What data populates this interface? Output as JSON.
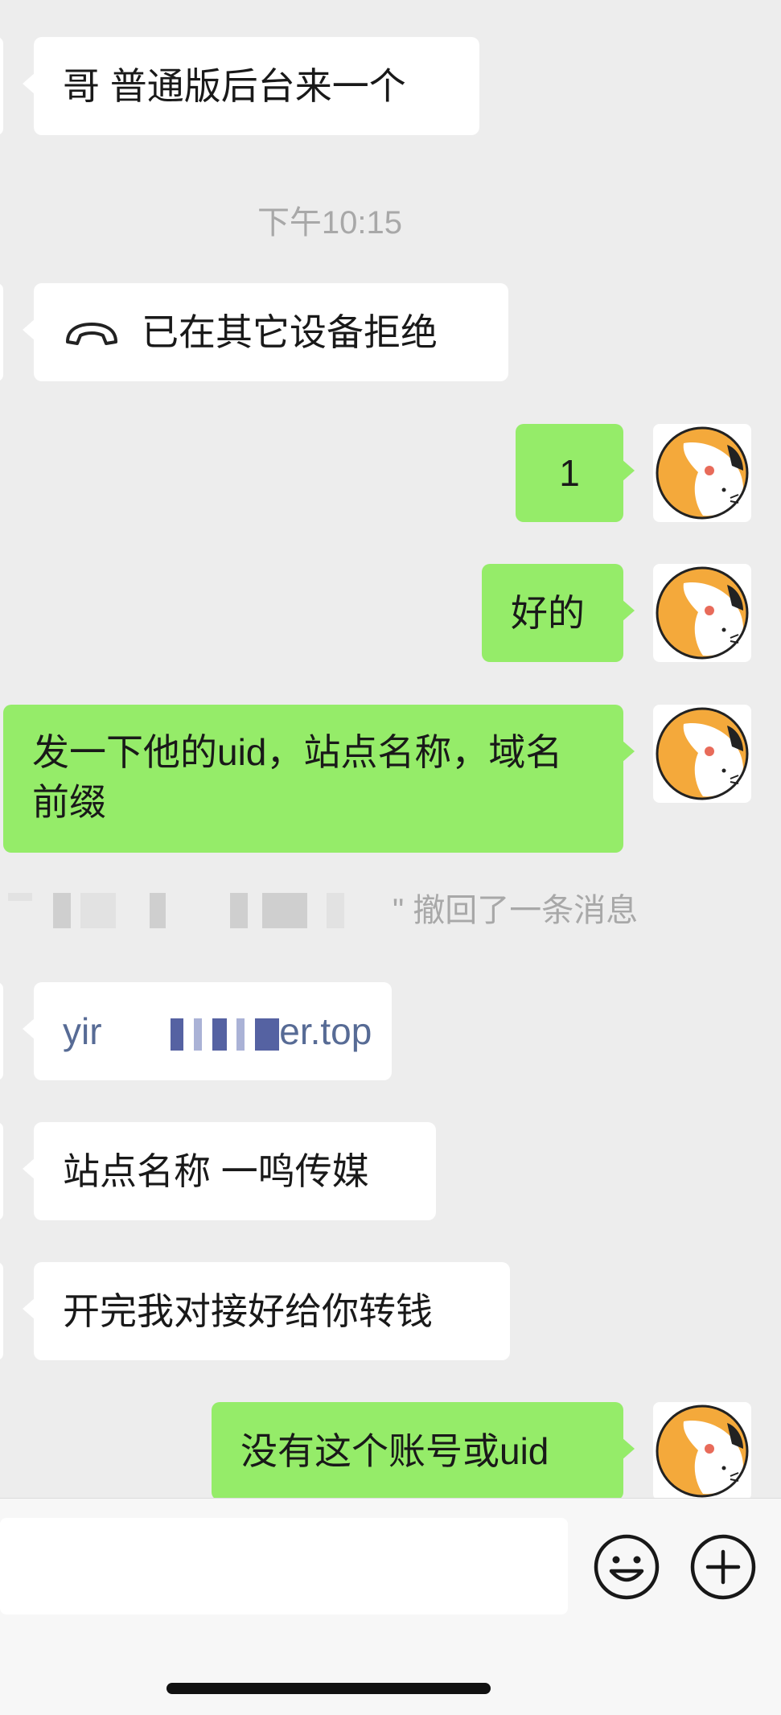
{
  "messages": {
    "m1": "哥 普通版后台来一个",
    "time": "下午10:15",
    "call": "已在其它设备拒绝",
    "m2": "1",
    "m3": "好的",
    "m4": "发一下他的uid，站点名称，域名前缀",
    "recall_suffix": "\" 撤回了一条消息",
    "link_start": "yir",
    "link_end": "er.top",
    "m5": "站点名称 一鸣传媒",
    "m6": "开完我对接好给你转钱",
    "m7": "没有这个账号或uid"
  },
  "icons": {
    "call": "phone-hangup-icon",
    "emoji": "emoji-icon",
    "plus": "plus-icon",
    "avatar": "cat-avatar-icon"
  },
  "colors": {
    "background": "#ededed",
    "sent_bubble": "#95ec69",
    "received_bubble": "#ffffff",
    "link": "#576b95",
    "system_text": "#a8a8a8"
  }
}
